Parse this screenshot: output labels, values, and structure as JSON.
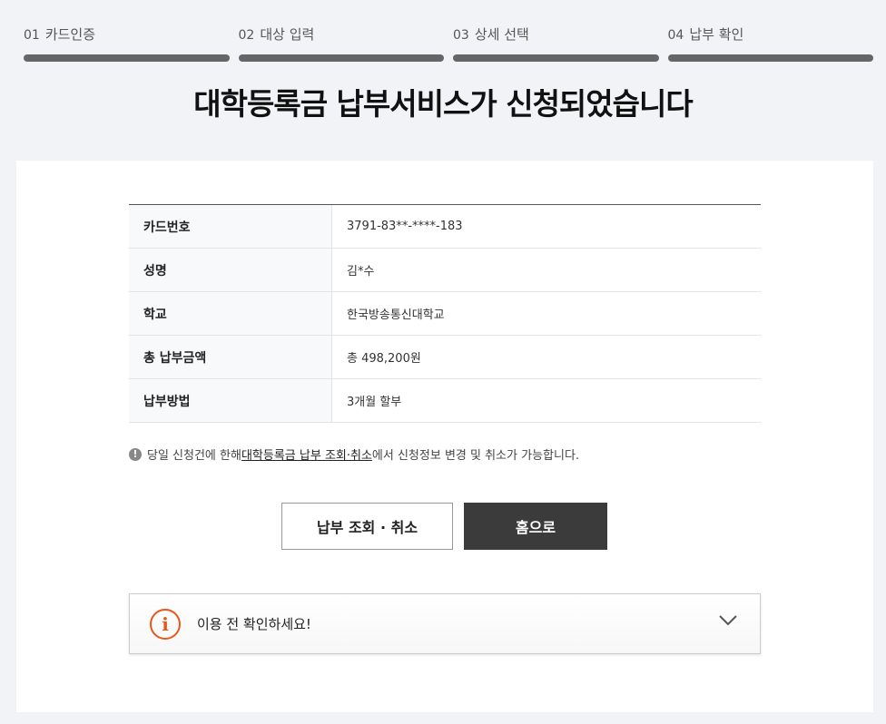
{
  "steps": [
    {
      "num": "01",
      "label": "카드인증"
    },
    {
      "num": "02",
      "label": "대상 입력"
    },
    {
      "num": "03",
      "label": "상세 선택"
    },
    {
      "num": "04",
      "label": "납부 확인"
    }
  ],
  "title": "대학등록금 납부서비스가 신청되었습니다",
  "details": [
    {
      "label": "카드번호",
      "value": "3791-83**-****-183"
    },
    {
      "label": "성명",
      "value": "김*수"
    },
    {
      "label": "학교",
      "value": "한국방송통신대학교"
    },
    {
      "label": "총 납부금액",
      "value": "총 498,200원"
    },
    {
      "label": "납부방법",
      "value": "3개월 할부"
    }
  ],
  "notice": {
    "icon": "alert-circle-icon",
    "prefix": "당일 신청건에 한해 ",
    "link": "대학등록금 납부 조회·취소",
    "suffix": "에서 신청정보 변경 및 취소가 가능합니다."
  },
  "buttons": {
    "inquiry_cancel": "납부 조회 · 취소",
    "home": "홈으로"
  },
  "accordion": {
    "icon": "info-icon",
    "label": "이용 전 확인하세요!",
    "accent": "#e8561a"
  }
}
